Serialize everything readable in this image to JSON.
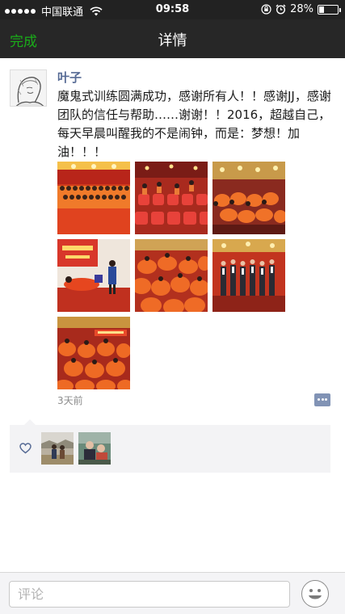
{
  "status_bar": {
    "carrier": "中国联通",
    "time": "09:58",
    "battery": "28%",
    "battery_level": 0.28,
    "signal_icon": "signal-dots-icon",
    "wifi_icon": "wifi-icon",
    "lock_icon": "rotation-lock-icon",
    "alarm_icon": "alarm-icon"
  },
  "nav": {
    "back_label": "完成",
    "title": "详情"
  },
  "post": {
    "author": "叶子",
    "text": "魔鬼式训练圆满成功，感谢所有人！！感谢JJ，感谢团队的信任与帮助……谢谢！！2016，超越自己，每天早晨叫醒我的不是闹钟，而是：梦想！加油！！！",
    "time_ago": "3天前",
    "photo_count": 7,
    "comment_icon": "comment-bubble-icon"
  },
  "likes": {
    "icon": "heart-icon",
    "liker_count": 2
  },
  "bottom_bar": {
    "comment_placeholder": "评论",
    "emoji_icon": "emoji-smile-icon"
  },
  "colors": {
    "accent_green": "#1aad19",
    "author_blue": "#576b95",
    "nav_bg": "#272727",
    "photo_red": "#c8321e",
    "photo_orange": "#e85a1f"
  }
}
